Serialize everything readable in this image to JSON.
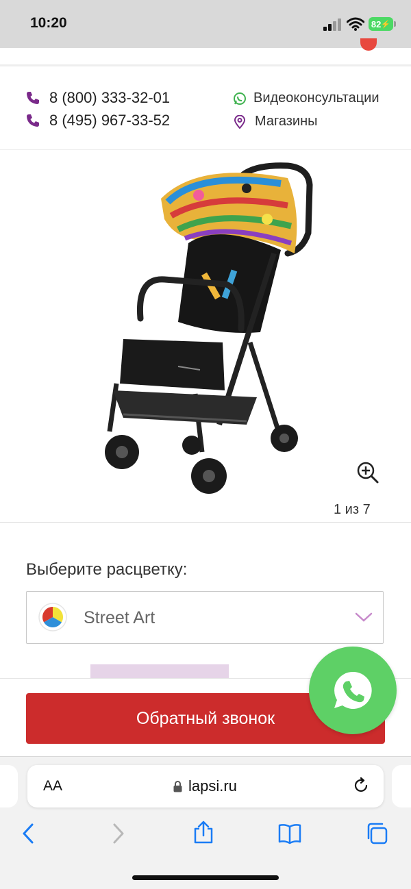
{
  "status_bar": {
    "time": "10:20",
    "battery": "82"
  },
  "contacts": {
    "phones": [
      "8 (800) 333-32-01",
      "8 (495) 967-33-52"
    ],
    "video_consult": "Видеоконсультации",
    "stores": "Магазины"
  },
  "gallery": {
    "counter": "1 из 7"
  },
  "color_select": {
    "label": "Выберите расцветку:",
    "value": "Street Art"
  },
  "callback_label": "Обратный звонок",
  "browser": {
    "text_size": "AA",
    "url": "lapsi.ru"
  },
  "colors": {
    "accent_red": "#cc2c2c",
    "phone_purple": "#7a2a8a",
    "whatsapp_green": "#5ed066",
    "ios_blue": "#1a7cf5"
  },
  "icons": [
    "phone-icon",
    "whatsapp-icon",
    "location-pin-icon",
    "zoom-in-icon",
    "chevron-down-icon",
    "lock-icon",
    "reload-icon",
    "back-icon",
    "forward-icon",
    "share-icon",
    "bookmarks-icon",
    "tabs-icon"
  ]
}
